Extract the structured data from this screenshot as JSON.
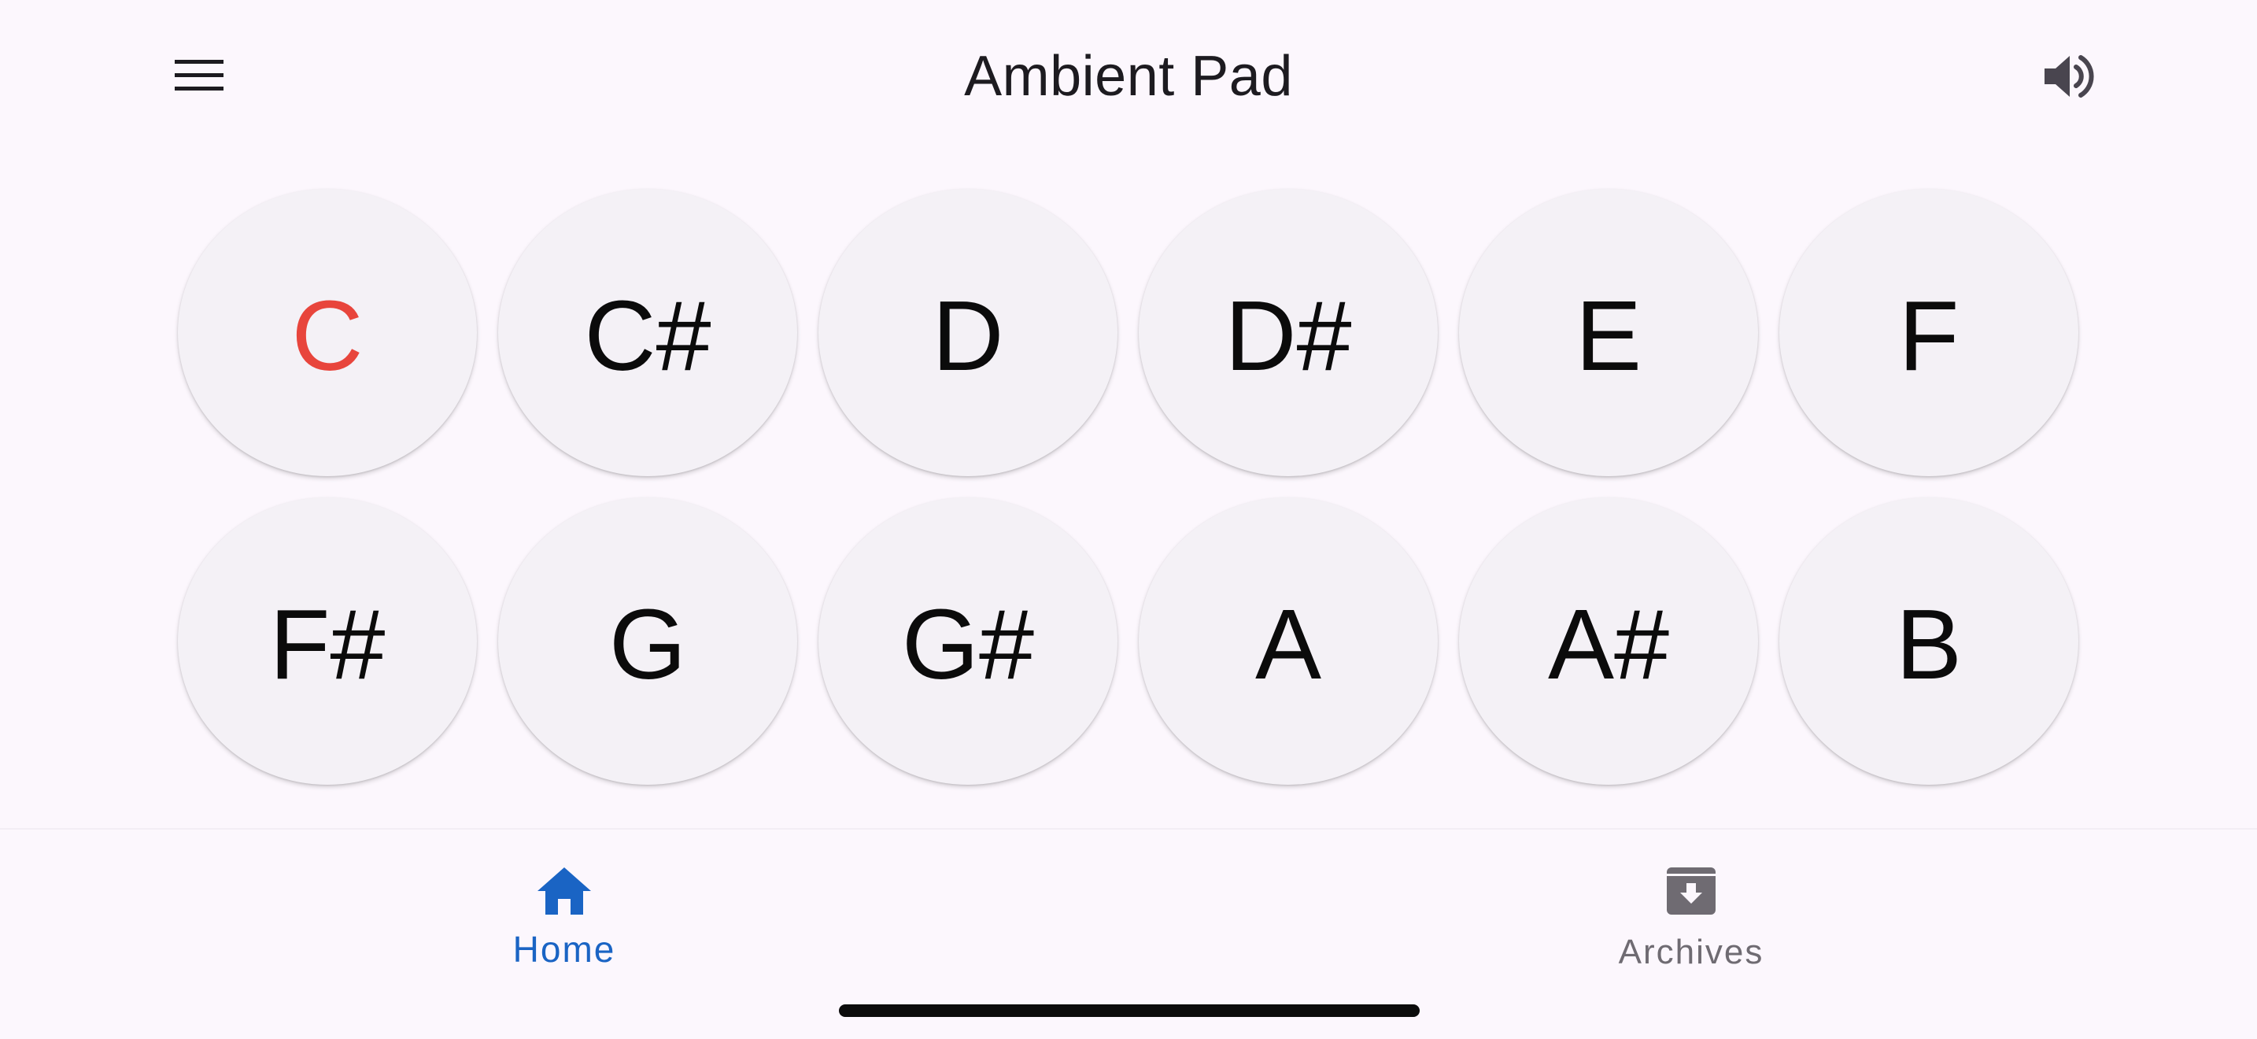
{
  "app_bar": {
    "title": "Ambient Pad",
    "menu_icon": "menu-icon",
    "volume_icon": "volume-icon"
  },
  "pads": [
    {
      "note": "C",
      "active": true
    },
    {
      "note": "C#",
      "active": false
    },
    {
      "note": "D",
      "active": false
    },
    {
      "note": "D#",
      "active": false
    },
    {
      "note": "E",
      "active": false
    },
    {
      "note": "F",
      "active": false
    },
    {
      "note": "F#",
      "active": false
    },
    {
      "note": "G",
      "active": false
    },
    {
      "note": "G#",
      "active": false
    },
    {
      "note": "A",
      "active": false
    },
    {
      "note": "A#",
      "active": false
    },
    {
      "note": "B",
      "active": false
    }
  ],
  "bottom_nav": {
    "items": [
      {
        "label": "Home",
        "icon": "home-icon",
        "selected": true
      },
      {
        "label": "Archives",
        "icon": "archive-icon",
        "selected": false
      }
    ]
  },
  "colors": {
    "background": "#fcf7fd",
    "pad": "#f4f1f6",
    "active_note": "#e8453c",
    "nav_selected": "#1a64c4",
    "nav_unselected": "#6f6b72"
  }
}
